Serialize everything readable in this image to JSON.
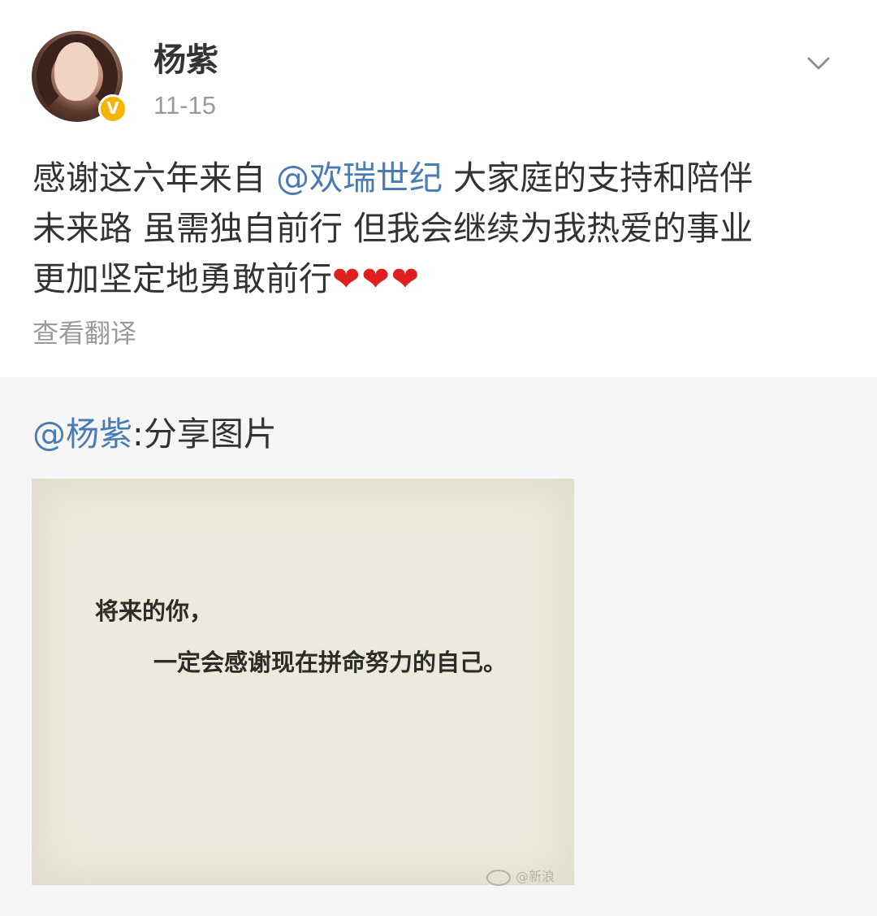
{
  "post": {
    "author": "杨紫",
    "time": "11-15",
    "verified_badge": "V",
    "body": {
      "line1_prefix": "感谢这六年来自",
      "line1_mention": "@欢瑞世纪",
      "line1_suffix": "大家庭的支持和陪伴",
      "line2": "未来路 虽需独自前行 但我会继续为我热爱的事业",
      "line3_text": "更加坚定地勇敢前行",
      "line3_emoji": "❤❤❤"
    },
    "translate_label": "查看翻译"
  },
  "repost": {
    "mention": "@杨紫",
    "text": ":分享图片",
    "image": {
      "quote_line1": "将来的你，",
      "quote_line2": "一定会感谢现在拼命努力的自己。",
      "watermark": "@新浪"
    }
  },
  "icons": {
    "menu": "chevron-down-icon",
    "avatar": "avatar",
    "badge": "verified-badge-icon"
  },
  "colors": {
    "mention": "#4a7bb3",
    "time": "#9a9a9a",
    "badge": "#f5b400",
    "heart": "#e02020",
    "repost_bg": "#f6f6f6"
  }
}
